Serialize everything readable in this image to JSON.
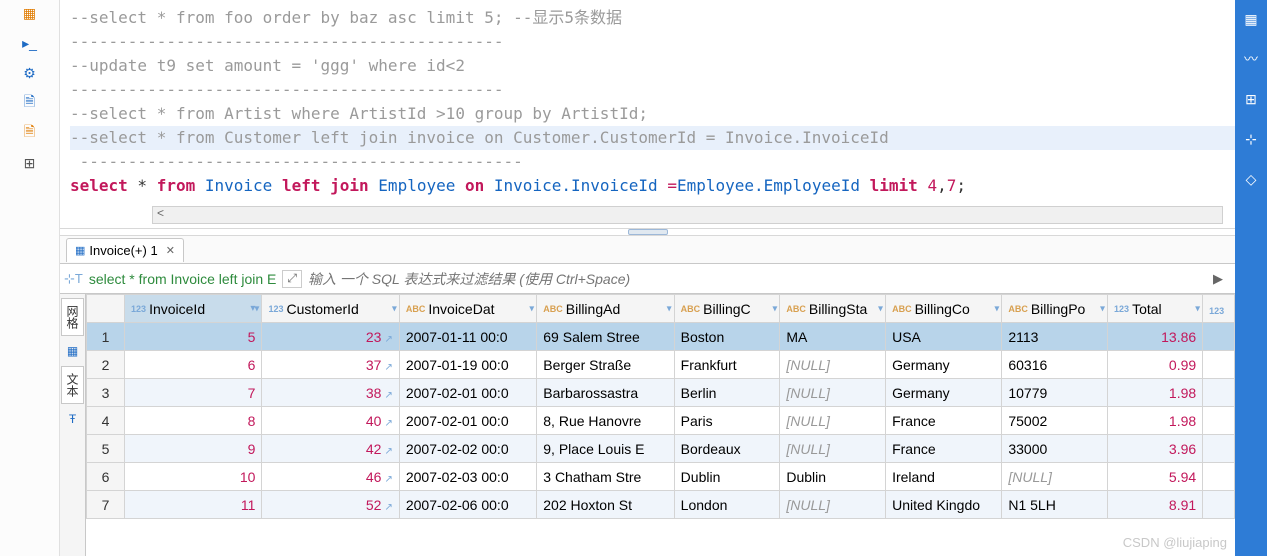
{
  "editor": {
    "lines": [
      {
        "type": "comment",
        "text": "--select * from foo order by baz asc limit 5; --显示5条数据"
      },
      {
        "type": "comment",
        "text": "---------------------------------------------"
      },
      {
        "type": "comment",
        "text": "--update t9 set amount = 'ggg' where id<2"
      },
      {
        "type": "comment",
        "text": "---------------------------------------------"
      },
      {
        "type": "comment",
        "text": "--select * from Artist where ArtistId >10 group by ArtistId;"
      },
      {
        "type": "comment-hl",
        "text": "--select * from Customer left join invoice on Customer.CustomerId = Invoice.InvoiceId"
      },
      {
        "type": "comment",
        "text": " ----------------------------------------------"
      }
    ],
    "sql": {
      "kw1": "select",
      "star": "*",
      "kw2": "from",
      "tbl1": "Invoice",
      "kw3": "left join",
      "tbl2": "Employee",
      "kw4": "on",
      "expr1": "Invoice.InvoiceId",
      "eq": "=",
      "expr2": "Employee.EmployeeId",
      "kw5": "limit",
      "n1": "4",
      "comma": ",",
      "n2": "7",
      "semi": ";"
    }
  },
  "resultsTab": {
    "label": "Invoice(+) 1"
  },
  "filter": {
    "query": "select * from Invoice left join E",
    "placeholder": "输入 一个 SQL 表达式来过滤结果 (使用 Ctrl+Space)"
  },
  "sideTabs": {
    "t1": "网格",
    "t2": "文本"
  },
  "columns": [
    {
      "name": "InvoiceId",
      "type": "123",
      "w": 130,
      "sel": true
    },
    {
      "name": "CustomerId",
      "type": "123",
      "w": 130
    },
    {
      "name": "InvoiceDat",
      "type": "ABC",
      "w": 130
    },
    {
      "name": "BillingAd",
      "type": "ABC",
      "w": 130
    },
    {
      "name": "BillingC",
      "type": "ABC",
      "w": 100
    },
    {
      "name": "BillingSta",
      "type": "ABC",
      "w": 100
    },
    {
      "name": "BillingCo",
      "type": "ABC",
      "w": 110
    },
    {
      "name": "BillingPo",
      "type": "ABC",
      "w": 100
    },
    {
      "name": "Total",
      "type": "123",
      "w": 90
    }
  ],
  "rows": [
    {
      "n": "1",
      "sel": true,
      "InvoiceId": "5",
      "CustomerId": "23",
      "InvoiceDat": "2007-01-11 00:0",
      "BillingAd": "69 Salem Stree",
      "BillingC": "Boston",
      "BillingSta": "MA",
      "BillingCo": "USA",
      "BillingPo": "2113",
      "Total": "13.86"
    },
    {
      "n": "2",
      "InvoiceId": "6",
      "CustomerId": "37",
      "InvoiceDat": "2007-01-19 00:0",
      "BillingAd": "Berger Straße ",
      "BillingC": "Frankfurt",
      "BillingSta": null,
      "BillingCo": "Germany",
      "BillingPo": "60316",
      "Total": "0.99"
    },
    {
      "n": "3",
      "InvoiceId": "7",
      "CustomerId": "38",
      "InvoiceDat": "2007-02-01 00:0",
      "BillingAd": "Barbarossastra",
      "BillingC": "Berlin",
      "BillingSta": null,
      "BillingCo": "Germany",
      "BillingPo": "10779",
      "Total": "1.98"
    },
    {
      "n": "4",
      "InvoiceId": "8",
      "CustomerId": "40",
      "InvoiceDat": "2007-02-01 00:0",
      "BillingAd": "8, Rue Hanovre",
      "BillingC": "Paris",
      "BillingSta": null,
      "BillingCo": "France",
      "BillingPo": "75002",
      "Total": "1.98"
    },
    {
      "n": "5",
      "InvoiceId": "9",
      "CustomerId": "42",
      "InvoiceDat": "2007-02-02 00:0",
      "BillingAd": "9, Place Louis E",
      "BillingC": "Bordeaux",
      "BillingSta": null,
      "BillingCo": "France",
      "BillingPo": "33000",
      "Total": "3.96"
    },
    {
      "n": "6",
      "InvoiceId": "10",
      "CustomerId": "46",
      "InvoiceDat": "2007-02-03 00:0",
      "BillingAd": "3 Chatham Stre",
      "BillingC": "Dublin",
      "BillingSta": "Dublin",
      "BillingCo": "Ireland",
      "BillingPo": null,
      "Total": "5.94"
    },
    {
      "n": "7",
      "InvoiceId": "11",
      "CustomerId": "52",
      "InvoiceDat": "2007-02-06 00:0",
      "BillingAd": "202 Hoxton St",
      "BillingC": "London",
      "BillingSta": null,
      "BillingCo": "United Kingdo",
      "BillingPo": "N1 5LH",
      "Total": "8.91"
    }
  ],
  "watermark": "CSDN @liujiaping",
  "nullText": "[NULL]"
}
